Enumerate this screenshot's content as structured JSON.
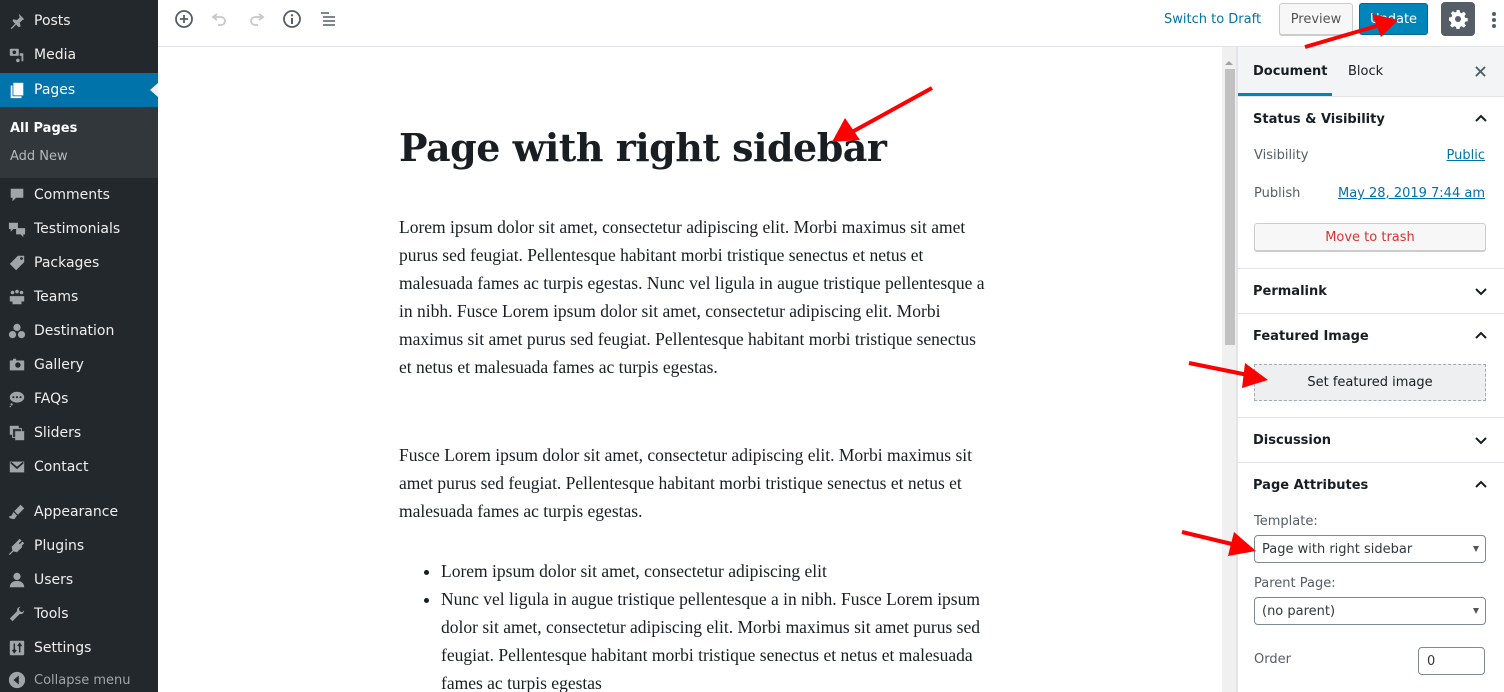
{
  "admin_menu": {
    "items": [
      {
        "label": "Posts",
        "icon": "pin-icon"
      },
      {
        "label": "Media",
        "icon": "media-icon"
      },
      {
        "label": "Pages",
        "icon": "pages-icon",
        "active": true
      },
      {
        "label": "Comments",
        "icon": "comment-icon"
      },
      {
        "label": "Testimonials",
        "icon": "testimonials-icon"
      },
      {
        "label": "Packages",
        "icon": "tag-icon"
      },
      {
        "label": "Teams",
        "icon": "groups-icon"
      },
      {
        "label": "Destination",
        "icon": "destination-icon"
      },
      {
        "label": "Gallery",
        "icon": "camera-icon"
      },
      {
        "label": "FAQs",
        "icon": "faq-bubble-icon"
      },
      {
        "label": "Sliders",
        "icon": "slides-icon"
      },
      {
        "label": "Contact",
        "icon": "email-icon"
      },
      {
        "label": "Appearance",
        "icon": "brush-icon"
      },
      {
        "label": "Plugins",
        "icon": "plugin-icon"
      },
      {
        "label": "Users",
        "icon": "user-icon"
      },
      {
        "label": "Tools",
        "icon": "wrench-icon"
      },
      {
        "label": "Settings",
        "icon": "settings-sliders-icon"
      }
    ],
    "submenu": [
      {
        "label": "All Pages",
        "current": true
      },
      {
        "label": "Add New"
      }
    ],
    "collapse_label": "Collapse menu"
  },
  "toolbar": {
    "switch_to_draft": "Switch to Draft",
    "preview": "Preview",
    "update": "Update"
  },
  "editor": {
    "title": "Page with right sidebar",
    "paragraphs": [
      "Lorem ipsum dolor sit amet, consectetur adipiscing elit. Morbi maximus sit amet purus sed feugiat. Pellentesque habitant morbi tristique senectus et netus et malesuada fames ac turpis egestas. Nunc vel ligula in augue tristique pellentesque a in nibh. Fusce Lorem ipsum dolor sit amet, consectetur adipiscing elit. Morbi maximus sit amet purus sed feugiat. Pellentesque habitant morbi tristique senectus et netus et malesuada fames ac turpis egestas.",
      "Fusce Lorem ipsum dolor sit amet, consectetur adipiscing elit. Morbi maximus sit amet purus sed feugiat. Pellentesque habitant morbi tristique senectus et netus et malesuada fames ac turpis egestas."
    ],
    "list_items": [
      "Lorem ipsum dolor sit amet, consectetur adipiscing elit",
      "Nunc vel ligula in augue tristique pellentesque a in nibh. Fusce Lorem ipsum dolor sit amet, consectetur adipiscing elit. Morbi maximus sit amet purus sed feugiat. Pellentesque habitant morbi tristique senectus et netus et malesuada fames ac turpis egestas"
    ]
  },
  "settings_sidebar": {
    "tabs": [
      "Document",
      "Block"
    ],
    "active_tab": "Document",
    "status_visibility": {
      "title": "Status & Visibility",
      "visibility_label": "Visibility",
      "visibility_value": "Public",
      "publish_label": "Publish",
      "publish_value": "May 28, 2019 7:44 am",
      "trash_button": "Move to trash"
    },
    "permalink": {
      "title": "Permalink"
    },
    "featured_image": {
      "title": "Featured Image",
      "button": "Set featured image"
    },
    "discussion": {
      "title": "Discussion"
    },
    "page_attributes": {
      "title": "Page Attributes",
      "template_label": "Template:",
      "template_value": "Page with right sidebar",
      "parent_label": "Parent Page:",
      "parent_value": "(no parent)",
      "order_label": "Order",
      "order_value": "0"
    }
  },
  "colors": {
    "admin_bg": "#23282d",
    "accent": "#0073aa",
    "primary_button": "#0085ba",
    "danger": "#dc3232",
    "annotation_arrow": "#ff0000"
  }
}
